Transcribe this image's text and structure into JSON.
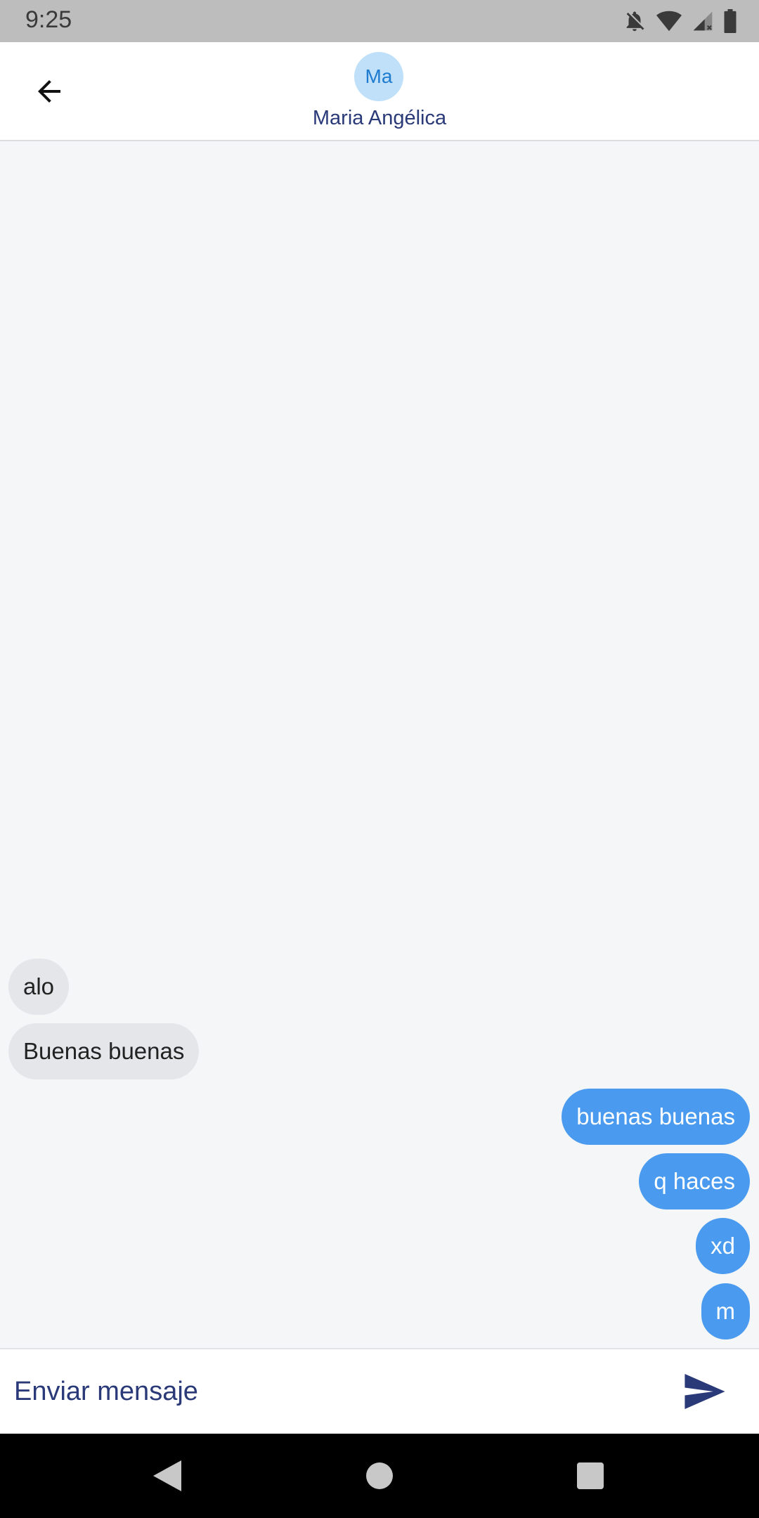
{
  "status_bar": {
    "time": "9:25",
    "icons": [
      "notifications-off-icon",
      "wifi-icon",
      "cellular-signal-icon",
      "battery-icon"
    ]
  },
  "header": {
    "avatar_initials": "Ma",
    "contact_name": "Maria Angélica",
    "back_icon": "arrow-left-icon"
  },
  "messages": [
    {
      "direction": "incoming",
      "text": "alo"
    },
    {
      "direction": "incoming",
      "text": "Buenas buenas"
    },
    {
      "direction": "outgoing",
      "text": "buenas buenas"
    },
    {
      "direction": "outgoing",
      "text": "q haces"
    },
    {
      "direction": "outgoing",
      "text": "xd"
    },
    {
      "direction": "outgoing",
      "text": "m"
    }
  ],
  "input": {
    "placeholder": "Enviar mensaje",
    "value": "",
    "send_icon": "send-icon"
  },
  "nav_bar": {
    "icons": [
      "nav-back-icon",
      "nav-home-icon",
      "nav-recents-icon"
    ]
  },
  "colors": {
    "accent": "#2a3a78",
    "outgoing_bubble": "#4a9bf0",
    "incoming_bubble": "#e4e6ea",
    "chat_background": "#f5f6f8",
    "avatar_background": "#bfe0f8"
  }
}
